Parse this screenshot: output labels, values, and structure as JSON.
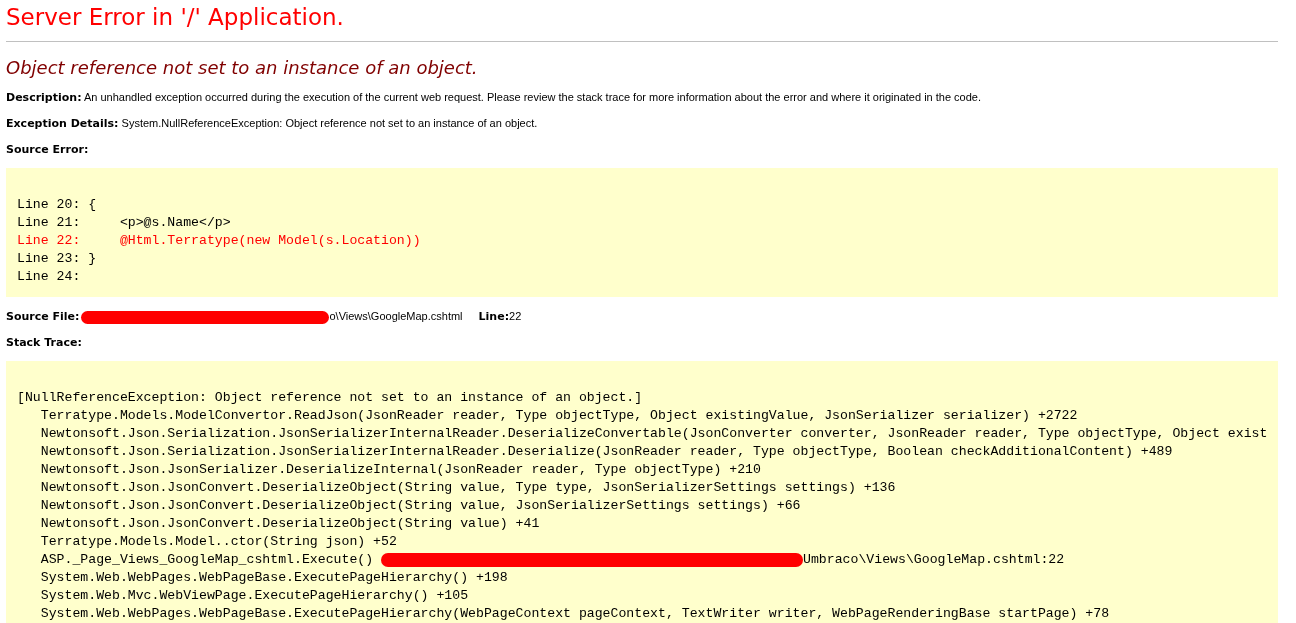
{
  "title": "Server Error in '/' Application.",
  "heading": "Object reference not set to an instance of an object.",
  "description": {
    "label": "Description:",
    "text": "An unhandled exception occurred during the execution of the current web request. Please review the stack trace for more information about the error and where it originated in the code."
  },
  "exception_details": {
    "label": "Exception Details:",
    "text": "System.NullReferenceException: Object reference not set to an instance of an object."
  },
  "source_error": {
    "label": "Source Error:",
    "lines": [
      {
        "text": "Line 20: {",
        "highlighted": false
      },
      {
        "text": "Line 21:     <p>@s.Name</p>",
        "highlighted": false
      },
      {
        "text": "Line 22:     @Html.Terratype(new Model(s.Location))",
        "highlighted": true
      },
      {
        "text": "Line 23: }",
        "highlighted": false
      },
      {
        "text": "Line 24:",
        "highlighted": false
      }
    ]
  },
  "source_file": {
    "label": "Source File:",
    "value": "o\\Views\\GoogleMap.cshtml",
    "line_label": "Line:",
    "line_value": "22"
  },
  "stack_trace": {
    "label": "Stack Trace:",
    "lines": [
      {
        "kind": "plain",
        "text": "[NullReferenceException: Object reference not set to an instance of an object.]"
      },
      {
        "kind": "plain",
        "text": "   Terratype.Models.ModelConvertor.ReadJson(JsonReader reader, Type objectType, Object existingValue, JsonSerializer serializer) +2722"
      },
      {
        "kind": "plain",
        "text": "   Newtonsoft.Json.Serialization.JsonSerializerInternalReader.DeserializeConvertable(JsonConverter converter, JsonReader reader, Type objectType, Object exist"
      },
      {
        "kind": "plain",
        "text": "   Newtonsoft.Json.Serialization.JsonSerializerInternalReader.Deserialize(JsonReader reader, Type objectType, Boolean checkAdditionalContent) +489"
      },
      {
        "kind": "plain",
        "text": "   Newtonsoft.Json.JsonSerializer.DeserializeInternal(JsonReader reader, Type objectType) +210"
      },
      {
        "kind": "plain",
        "text": "   Newtonsoft.Json.JsonConvert.DeserializeObject(String value, Type type, JsonSerializerSettings settings) +136"
      },
      {
        "kind": "plain",
        "text": "   Newtonsoft.Json.JsonConvert.DeserializeObject(String value, JsonSerializerSettings settings) +66"
      },
      {
        "kind": "plain",
        "text": "   Newtonsoft.Json.JsonConvert.DeserializeObject(String value) +41"
      },
      {
        "kind": "plain",
        "text": "   Terratype.Models.Model..ctor(String json) +52"
      },
      {
        "kind": "redacted",
        "text": "   ASP._Page_Views_GoogleMap_cshtml.Execute() ",
        "after": "Umbraco\\Views\\GoogleMap.cshtml:22"
      },
      {
        "kind": "plain",
        "text": "   System.Web.WebPages.WebPageBase.ExecutePageHierarchy() +198"
      },
      {
        "kind": "plain",
        "text": "   System.Web.Mvc.WebViewPage.ExecutePageHierarchy() +105"
      },
      {
        "kind": "plain",
        "text": "   System.Web.WebPages.WebPageBase.ExecutePageHierarchy(WebPageContext pageContext, TextWriter writer, WebPageRenderingBase startPage) +78"
      }
    ]
  }
}
